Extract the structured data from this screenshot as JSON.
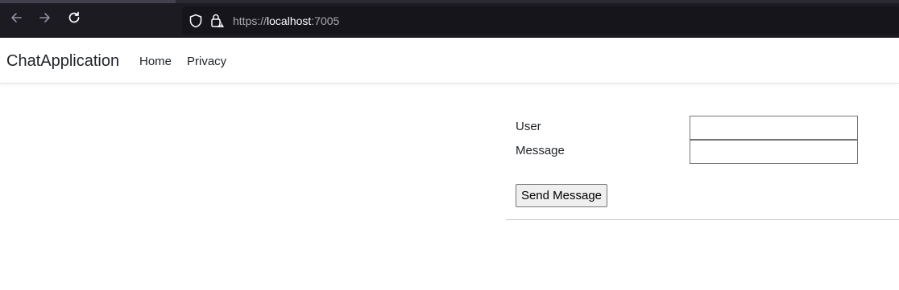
{
  "browser": {
    "url_scheme": "https://",
    "url_host": "localhost",
    "url_port": ":7005"
  },
  "navbar": {
    "brand": "ChatApplication",
    "links": [
      "Home",
      "Privacy"
    ]
  },
  "form": {
    "user_label": "User",
    "message_label": "Message",
    "user_value": "",
    "message_value": "",
    "send_label": "Send Message"
  },
  "icons": {
    "back": "arrow-left-icon",
    "forward": "arrow-right-icon",
    "reload": "reload-icon",
    "shield": "shield-icon",
    "lock": "lock-warning-icon"
  }
}
